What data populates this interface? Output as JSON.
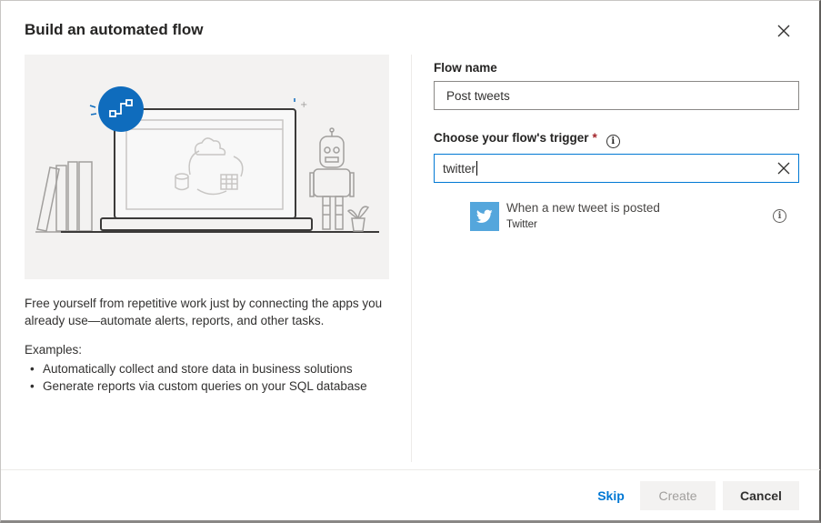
{
  "dialog": {
    "title": "Build an automated flow"
  },
  "left": {
    "description": "Free yourself from repetitive work just by connecting the apps you already use—automate alerts, reports, and other tasks.",
    "examples_title": "Examples:",
    "examples": [
      "Automatically collect and store data in business solutions",
      "Generate reports via custom queries on your SQL database"
    ]
  },
  "form": {
    "flow_name_label": "Flow name",
    "flow_name_value": "Post tweets",
    "trigger_label": "Choose your flow's trigger",
    "required_marker": "*",
    "search_value": "twitter",
    "results": [
      {
        "name": "When a new tweet is posted",
        "connector": "Twitter",
        "icon": "twitter-bird-icon",
        "icon_color": "#54a6dc"
      }
    ]
  },
  "footer": {
    "skip_label": "Skip",
    "create_label": "Create",
    "cancel_label": "Cancel"
  },
  "colors": {
    "accent": "#0078d4",
    "circle_accent": "#0f6cbd",
    "twitter": "#54a6dc"
  }
}
